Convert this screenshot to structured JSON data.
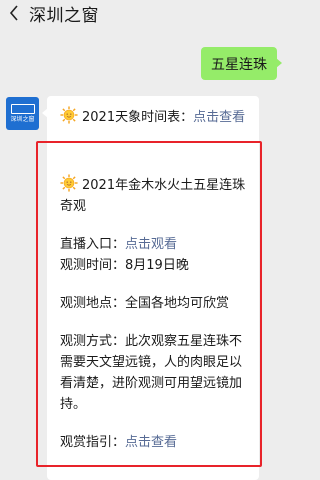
{
  "header": {
    "title": "深圳之窗"
  },
  "sent": {
    "text": "五星连珠"
  },
  "avatar": {
    "label": "深圳之窗"
  },
  "message": {
    "intro_text": "2021天象时间表：",
    "intro_link": "点击查看",
    "heading": "2021年金木水火土五星连珠奇观",
    "entry_label": "直播入口：",
    "entry_link": "点击观看",
    "time": "观测时间：8月19日晚",
    "location": "观测地点：全国各地均可欣赏",
    "method": "观测方式：此次观察五星连珠不需要天文望远镜，人的肉眼足以看清楚，进阶观测可用望远镜加持。",
    "guide_label": "观赏指引：",
    "guide_link": "点击查看"
  }
}
